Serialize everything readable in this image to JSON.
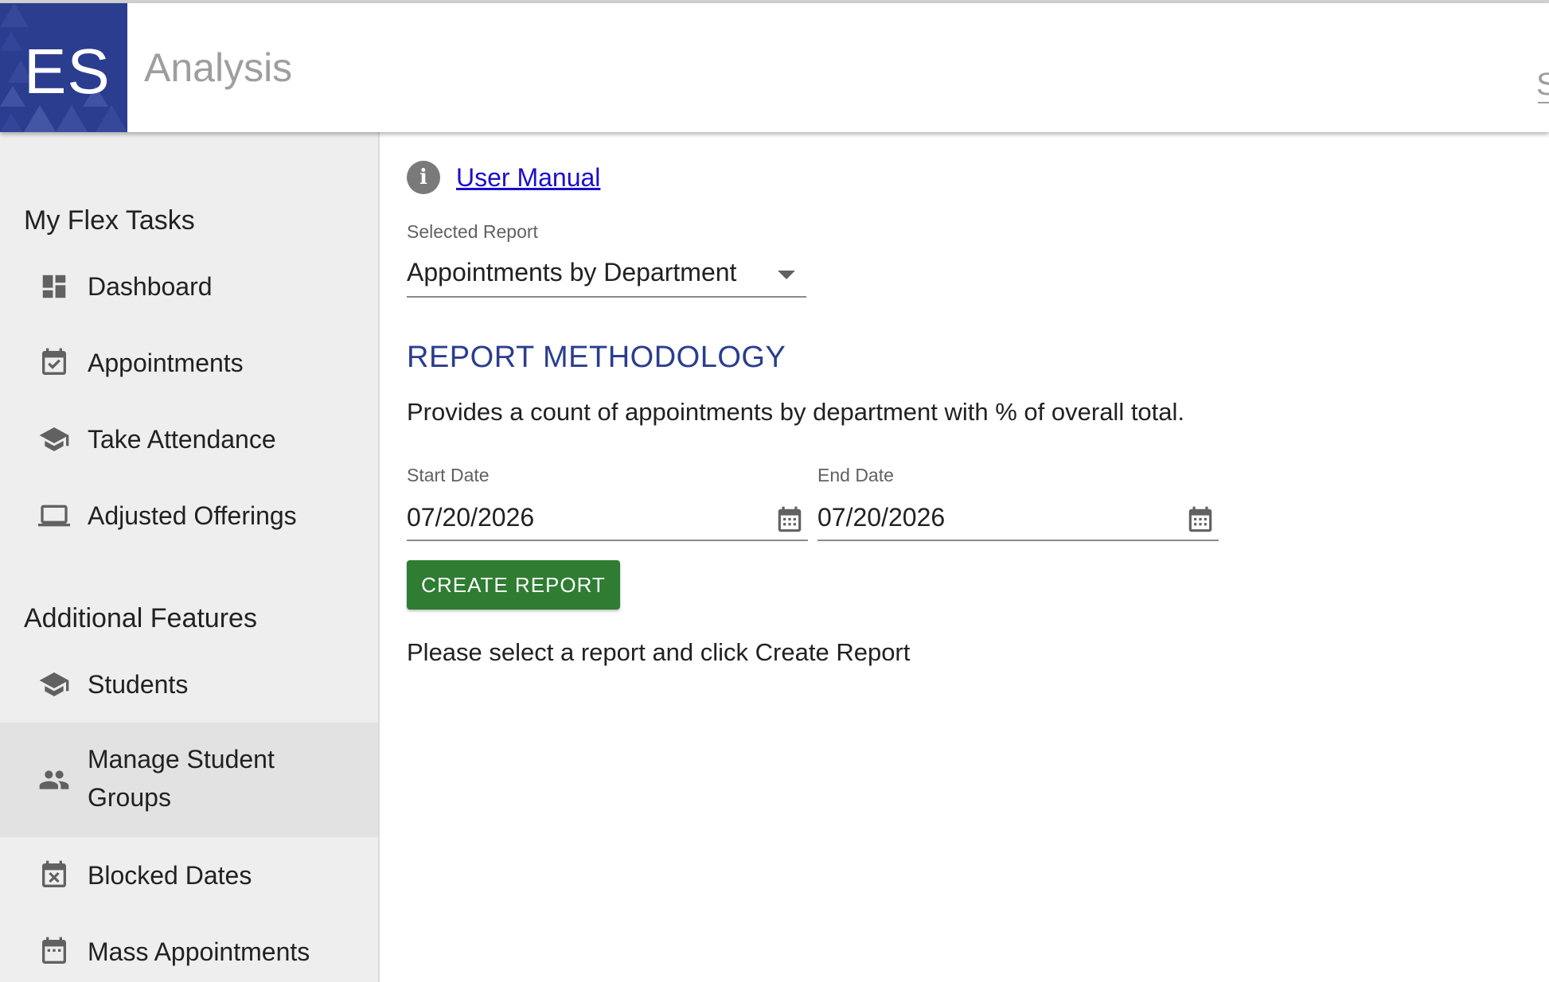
{
  "header": {
    "logo_text": "ES",
    "title": "Analysis",
    "edge_text": "S"
  },
  "sidebar": {
    "sections": [
      {
        "title": "My Flex Tasks",
        "items": [
          {
            "label": "Dashboard",
            "icon": "dashboard-icon"
          },
          {
            "label": "Appointments",
            "icon": "calendar-check-icon"
          },
          {
            "label": "Take Attendance",
            "icon": "school-icon"
          },
          {
            "label": "Adjusted Offerings",
            "icon": "laptop-icon"
          }
        ]
      },
      {
        "title": "Additional Features",
        "items": [
          {
            "label": "Students",
            "icon": "school-icon"
          },
          {
            "label": "Manage Student",
            "label2": "Groups",
            "icon": "people-icon",
            "active": true
          },
          {
            "label": "Blocked Dates",
            "icon": "calendar-x-icon"
          },
          {
            "label": "Mass Appointments",
            "icon": "calendar-grid-icon"
          }
        ]
      }
    ]
  },
  "main": {
    "user_manual_label": "User Manual",
    "selected_report": {
      "label": "Selected Report",
      "value": "Appointments by Department"
    },
    "methodology": {
      "title": "REPORT METHODOLOGY",
      "description": "Provides a count of appointments by department with % of overall total."
    },
    "start_date": {
      "label": "Start Date",
      "value": "07/20/2026"
    },
    "end_date": {
      "label": "End Date",
      "value": "07/20/2026"
    },
    "create_button_label": "CREATE REPORT",
    "hint": "Please select a report and click Create Report"
  },
  "colors": {
    "brand": "#2b3d8f",
    "button": "#2e7d32",
    "link": "#1a0dcc",
    "sidebar_bg": "#eeeeee"
  }
}
